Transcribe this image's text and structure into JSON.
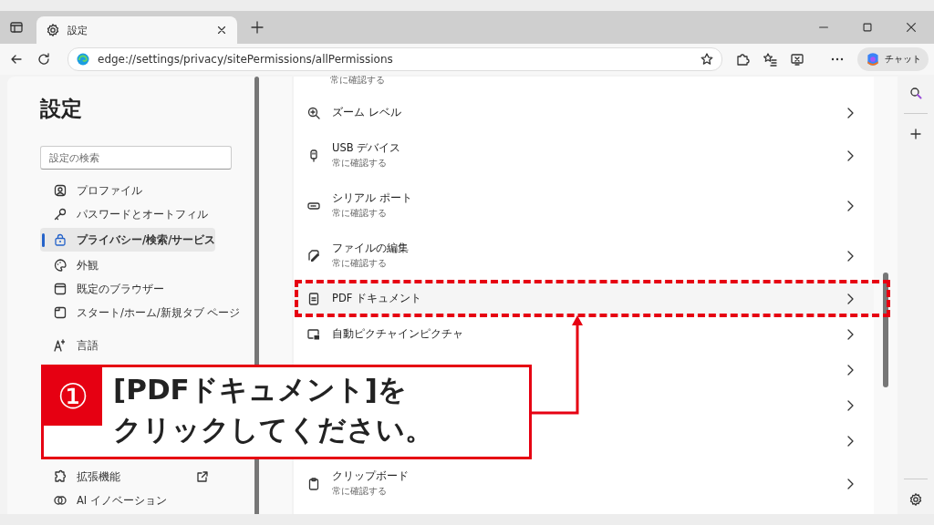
{
  "tab": {
    "title": "設定"
  },
  "address": "edge://settings/privacy/sitePermissions/allPermissions",
  "copilot_label": "チャット",
  "sidebar": {
    "title": "設定",
    "search_placeholder": "設定の検索",
    "groups": [
      {
        "items": [
          {
            "kind": "page",
            "label": "プロファイル",
            "selected": false
          },
          {
            "kind": "page",
            "label": "パスワードとオートフィル",
            "selected": false
          },
          {
            "kind": "page",
            "label": "プライバシー/検索/サービス",
            "selected": true
          },
          {
            "kind": "page",
            "label": "外観",
            "selected": false
          },
          {
            "kind": "page",
            "label": "既定のブラウザー",
            "selected": false
          },
          {
            "kind": "page",
            "label": "スタート/ホーム/新規タブ ページ",
            "selected": false
          }
        ]
      },
      {
        "items": [
          {
            "kind": "page",
            "label": "言語",
            "selected": false
          }
        ]
      },
      {
        "items": [
          {
            "kind": "external",
            "label": "拡張機能",
            "selected": false
          },
          {
            "kind": "page",
            "label": "AI イノベーション",
            "selected": false
          }
        ]
      }
    ]
  },
  "permissions": [
    {
      "kind": "cut",
      "subtitle": "常に確認する"
    },
    {
      "kind": "item",
      "label": "ズーム レベル",
      "highlighted": false
    },
    {
      "kind": "item",
      "label": "USB デバイス",
      "subtitle": "常に確認する",
      "highlighted": false
    },
    {
      "kind": "item",
      "label": "シリアル ポート",
      "subtitle": "常に確認する",
      "highlighted": false
    },
    {
      "kind": "item",
      "label": "ファイルの編集",
      "subtitle": "常に確認する",
      "highlighted": false
    },
    {
      "kind": "item",
      "label": "PDF ドキュメント",
      "highlighted": true
    },
    {
      "kind": "item",
      "label": "自動ピクチャインピクチャ",
      "highlighted": false
    },
    {
      "kind": "covered"
    },
    {
      "kind": "covered"
    },
    {
      "kind": "covered"
    },
    {
      "kind": "item",
      "label": "クリップボード",
      "subtitle": "常に確認する",
      "highlighted": false
    }
  ],
  "callout": {
    "number": "①",
    "lines": [
      "[PDFドキュメント]を",
      "クリックしてください。"
    ]
  }
}
